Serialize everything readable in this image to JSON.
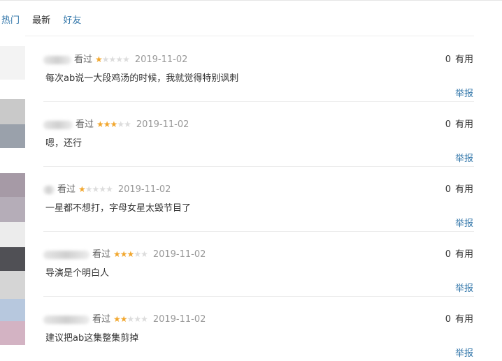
{
  "tabs": [
    {
      "label": "热门"
    },
    {
      "label": "最新"
    },
    {
      "label": "好友"
    }
  ],
  "comments": [
    {
      "status": "看过",
      "rating": 1,
      "date": "2019-11-02",
      "text": "每次ab说一大段鸡汤的时候，我就觉得特别讽刺",
      "votes_count": "0",
      "votes_label": "有用",
      "report_label": "举报"
    },
    {
      "status": "看过",
      "rating": 3,
      "date": "2019-11-02",
      "text": "嗯，还行",
      "votes_count": "0",
      "votes_label": "有用",
      "report_label": "举报"
    },
    {
      "status": "看过",
      "rating": 1,
      "date": "2019-11-02",
      "text": "一星都不想打，字母女星太毁节目了",
      "votes_count": "0",
      "votes_label": "有用",
      "report_label": "举报"
    },
    {
      "status": "看过",
      "rating": 3,
      "date": "2019-11-02",
      "text": "导演是个明白人",
      "votes_count": "0",
      "votes_label": "有用",
      "report_label": "举报"
    },
    {
      "status": "看过",
      "rating": 2,
      "date": "2019-11-02",
      "text": "建议把ab这集整集剪掉",
      "votes_count": "0",
      "votes_label": "有用",
      "report_label": "举报"
    }
  ],
  "colors": {
    "link": "#3377aa",
    "star_on": "#f1a62d",
    "star_off": "#dcdcdc"
  }
}
